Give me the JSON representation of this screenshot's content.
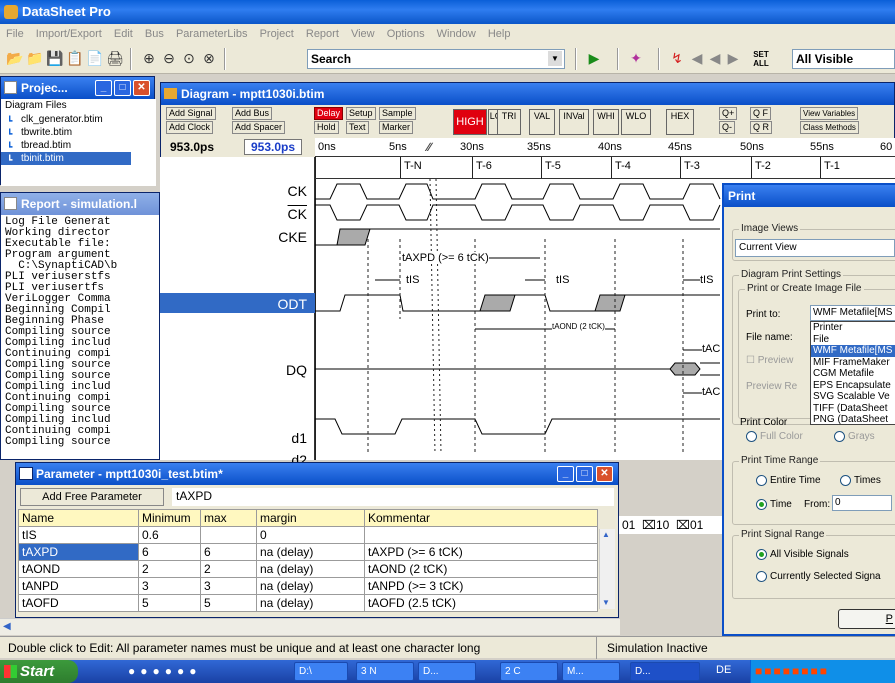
{
  "app": {
    "title": "DataSheet Pro"
  },
  "menu": [
    "File",
    "Import/Export",
    "Edit",
    "Bus",
    "ParameterLibs",
    "Project",
    "Report",
    "View",
    "Options",
    "Window",
    "Help"
  ],
  "toolbar": {
    "search_value": "Search",
    "view_selector": "All Visible",
    "set_all_label": "SET ALL"
  },
  "project_panel": {
    "title": "Projec...",
    "header": "Diagram Files",
    "files": [
      "clk_generator.btim",
      "tbwrite.btim",
      "tbread.btim",
      "tbinit.btim"
    ]
  },
  "report_panel": {
    "title": "Report - simulation.l",
    "lines": [
      "Log File Generat",
      "Working director",
      "Executable file:",
      "Program argument",
      "  C:\\SynaptiCAD\\b",
      "PLI veriuserstfs",
      "PLI veriusertfs",
      "VeriLogger Comma",
      "Beginning Compil",
      "Beginning Phase",
      "Compiling source",
      "Compiling includ",
      "Continuing compi",
      "Compiling source",
      "Compiling source",
      "Compiling includ",
      "Continuing compi",
      "Compiling source",
      "Compiling includ",
      "Continuing compi",
      "Compiling source"
    ]
  },
  "diagram": {
    "title": "Diagram - mptt1030i.btim",
    "buttons": {
      "add_signal": "Add Signal",
      "add_bus": "Add Bus",
      "add_clock": "Add Clock",
      "add_spacer": "Add Spacer",
      "delay": "Delay",
      "setup": "Setup",
      "sample": "Sample",
      "hold": "Hold",
      "text": "Text",
      "marker": "Marker",
      "high": "HIGH",
      "low": "LOW",
      "tri": "TRI",
      "val": "VAL",
      "inval": "INVal",
      "whi": "WHI",
      "wlo": "WLO",
      "hex": "HEX",
      "zoom_in": "Q+",
      "zoom_f": "Q F",
      "zoom_out": "Q-",
      "zoom_r": "Q R",
      "view_variables": "View Variables",
      "class_methods": "Class Methods"
    },
    "time_left": "953.0ps",
    "time_right": "953.0ps",
    "ruler": [
      "0ns",
      "5ns",
      "30ns",
      "35ns",
      "40ns",
      "45ns",
      "50ns",
      "55ns",
      "60"
    ],
    "time_labels": [
      "T-N",
      "T-6",
      "T-5",
      "T-4",
      "T-3",
      "T-2",
      "T-1"
    ],
    "signals": [
      "CK",
      "CK",
      "CKE",
      "ODT",
      "DQ",
      "d1",
      "d2"
    ],
    "annotations": {
      "taxpd": "tAXPD (>= 6 tCK)",
      "tis1": "tIS",
      "tis2": "tIS",
      "tis3": "tIS",
      "taond": "tAOND (2 tCK)",
      "tac1": "tAC",
      "tac2": "tAC"
    },
    "bus_values": [
      "01",
      "10",
      "01"
    ]
  },
  "parameter": {
    "title": "Parameter - mptt1030i_test.btim*",
    "add_button": "Add Free Parameter",
    "edit_value": "tAXPD",
    "columns": [
      "Name",
      "Minimum",
      "max",
      "margin",
      "Kommentar"
    ],
    "rows": [
      [
        "tIS",
        "0.6",
        "",
        "0",
        ""
      ],
      [
        "tAXPD",
        "6",
        "6",
        "na (delay)",
        "tAXPD (>= 6 tCK)"
      ],
      [
        "tAOND",
        "2",
        "2",
        "na (delay)",
        "tAOND (2 tCK)"
      ],
      [
        "tANPD",
        "3",
        "3",
        "na (delay)",
        "tANPD (>= 3 tCK)"
      ],
      [
        "tAOFD",
        "5",
        "5",
        "na (delay)",
        "tAOFD (2.5 tCK)"
      ]
    ]
  },
  "print_dialog": {
    "title": "Print",
    "image_views_label": "Image Views",
    "image_views_value": "Current View",
    "diagram_settings_label": "Diagram Print Settings",
    "print_or_create_label": "Print or Create Image File",
    "print_to_label": "Print to:",
    "print_to_value": "WMF Metafile[MS",
    "file_name_label": "File name:",
    "options": [
      "Printer",
      "File",
      "WMF Metafile[MS",
      "MIF FrameMaker",
      "CGM Metafile",
      "EPS Encapsulate",
      "SVG Scalable Ve",
      "TIFF (DataSheet",
      "PNG (DataSheet"
    ],
    "preview_label": "Preview",
    "preview_re_label": "Preview Re",
    "print_color_label": "Print Color",
    "full_color": "Full Color",
    "grays": "Grays",
    "time_range_label": "Print Time Range",
    "entire_time": "Entire Time",
    "times": "Times",
    "time_label": "Time",
    "from_label": "From:",
    "from_value": "0",
    "signal_range_label": "Print Signal Range",
    "all_visible": "All Visible Signals",
    "currently_selected": "Currently Selected Signa",
    "bottom_button": "P"
  },
  "status": {
    "message": "Double click to Edit: All parameter names must be unique and at least one character long",
    "sim_state": "Simulation Inactive"
  },
  "taskbar": {
    "start": "Start",
    "tasks": [
      "D:\\",
      "3 N",
      "D...",
      "2 C",
      "M...",
      "D..."
    ],
    "lang": "DE"
  }
}
